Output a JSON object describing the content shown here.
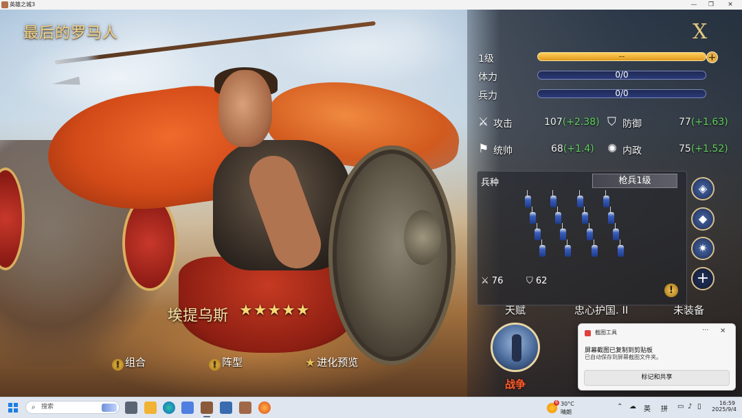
{
  "window": {
    "title": "英雄之城3",
    "controls": [
      "minimize",
      "maximize",
      "close"
    ]
  },
  "game": {
    "title": "最后的罗马人",
    "hero_name": "埃提乌斯",
    "hero_stars": "★★★★★",
    "bottom_buttons": {
      "combo": "组合",
      "formation": "阵型",
      "evolution": "进化预览"
    },
    "close_symbol": "X"
  },
  "panel": {
    "level_label": "1级",
    "level_bar_value": "--",
    "stamina_label": "体力",
    "stamina_value": "0/0",
    "troops_label": "兵力",
    "troops_value": "0/0",
    "stats": {
      "attack": {
        "label": "攻击",
        "value": "107",
        "bonus": "(+2.38)"
      },
      "defense": {
        "label": "防御",
        "value": "77",
        "bonus": "(+1.63)"
      },
      "command": {
        "label": "统帅",
        "value": "68",
        "bonus": "(+1.4)"
      },
      "politics": {
        "label": "内政",
        "value": "75",
        "bonus": "(+1.52)"
      }
    },
    "troop": {
      "header": "兵种",
      "type": "枪兵1级",
      "attack": "76",
      "defense": "62",
      "warn_icon": "!"
    },
    "sections": {
      "talent": "天赋",
      "trait": "忠心护国. II",
      "equipment": "未装备",
      "war": "战争"
    }
  },
  "toast": {
    "app": "截图工具",
    "title": "屏幕截图已复制到剪贴板",
    "body": "已自动保存到屏幕截图文件夹。",
    "button": "标记和共享",
    "more": "···",
    "close": "✕"
  },
  "taskbar": {
    "search_placeholder": "搜索",
    "weather_temp": "30°C",
    "weather_desc": "晴朗",
    "weather_badge": "6",
    "ime_lang": "英",
    "ime_mode": "拼",
    "time": "16:59",
    "date": "2025/9/4"
  }
}
